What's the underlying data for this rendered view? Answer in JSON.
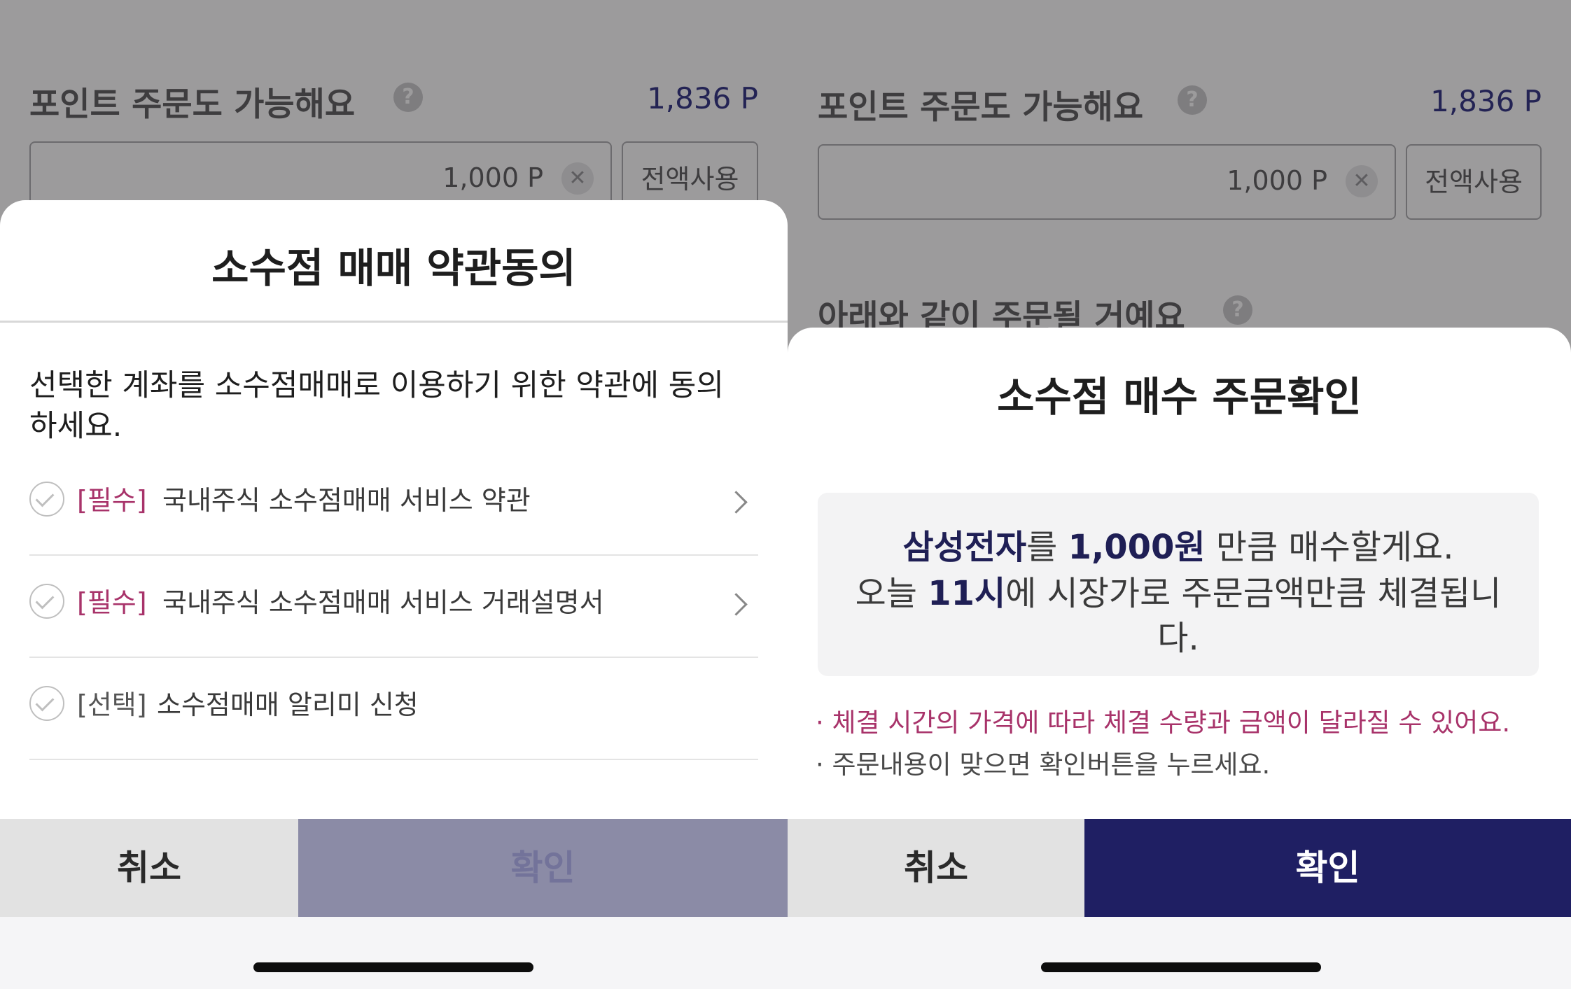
{
  "left": {
    "background": {
      "section_title": "포인트 주문도 가능해요",
      "help_icon": "question-mark",
      "available_points": "1,836 P",
      "point_input_value": "1,000 P",
      "use_all_label": "전액사용"
    },
    "sheet": {
      "title": "소수점 매매 약관동의",
      "description_line1": "선택한 계좌를 소수점매매로 이용하기 위한 약관에 동의",
      "description_line2": "하세요.",
      "terms": [
        {
          "tag": "[필수]",
          "label": "국내주식 소수점매매 서비스 약관"
        },
        {
          "tag": "[필수]",
          "label": "국내주식 소수점매매 서비스 거래설명서"
        },
        {
          "tag": "[선택]",
          "label": "소수점매매 알리미 신청"
        }
      ]
    },
    "buttons": {
      "cancel": "취소",
      "confirm": "확인"
    }
  },
  "right": {
    "background": {
      "section_title": "포인트 주문도 가능해요",
      "available_points": "1,836 P",
      "point_input_value": "1,000 P",
      "use_all_label": "전액사용",
      "section_title2": "아래와 같이 주문될 거예요"
    },
    "sheet": {
      "title": "소수점 매수 주문확인",
      "summary": {
        "stock": "삼성전자",
        "particle1": "를 ",
        "amount": "1,000원",
        "rest1": " 만큼 매수할게요.",
        "today": "오늘 ",
        "time": "11시",
        "rest2": "에 시장가로 주문금액만큼 체결됩니",
        "rest3": "다."
      },
      "notice_warn": "· 체결 시간의 가격에 따라 체결 수량과 금액이 달라질 수 있어요.",
      "notice_info": "· 주문내용이 맞으면 확인버튼을 누르세요."
    },
    "buttons": {
      "cancel": "취소",
      "confirm": "확인"
    }
  },
  "colors": {
    "accent_navy": "#1f1f63",
    "required_tag": "#a8336a",
    "disabled_confirm": "#8b8ba6",
    "overlay": "#9c9b9c"
  }
}
